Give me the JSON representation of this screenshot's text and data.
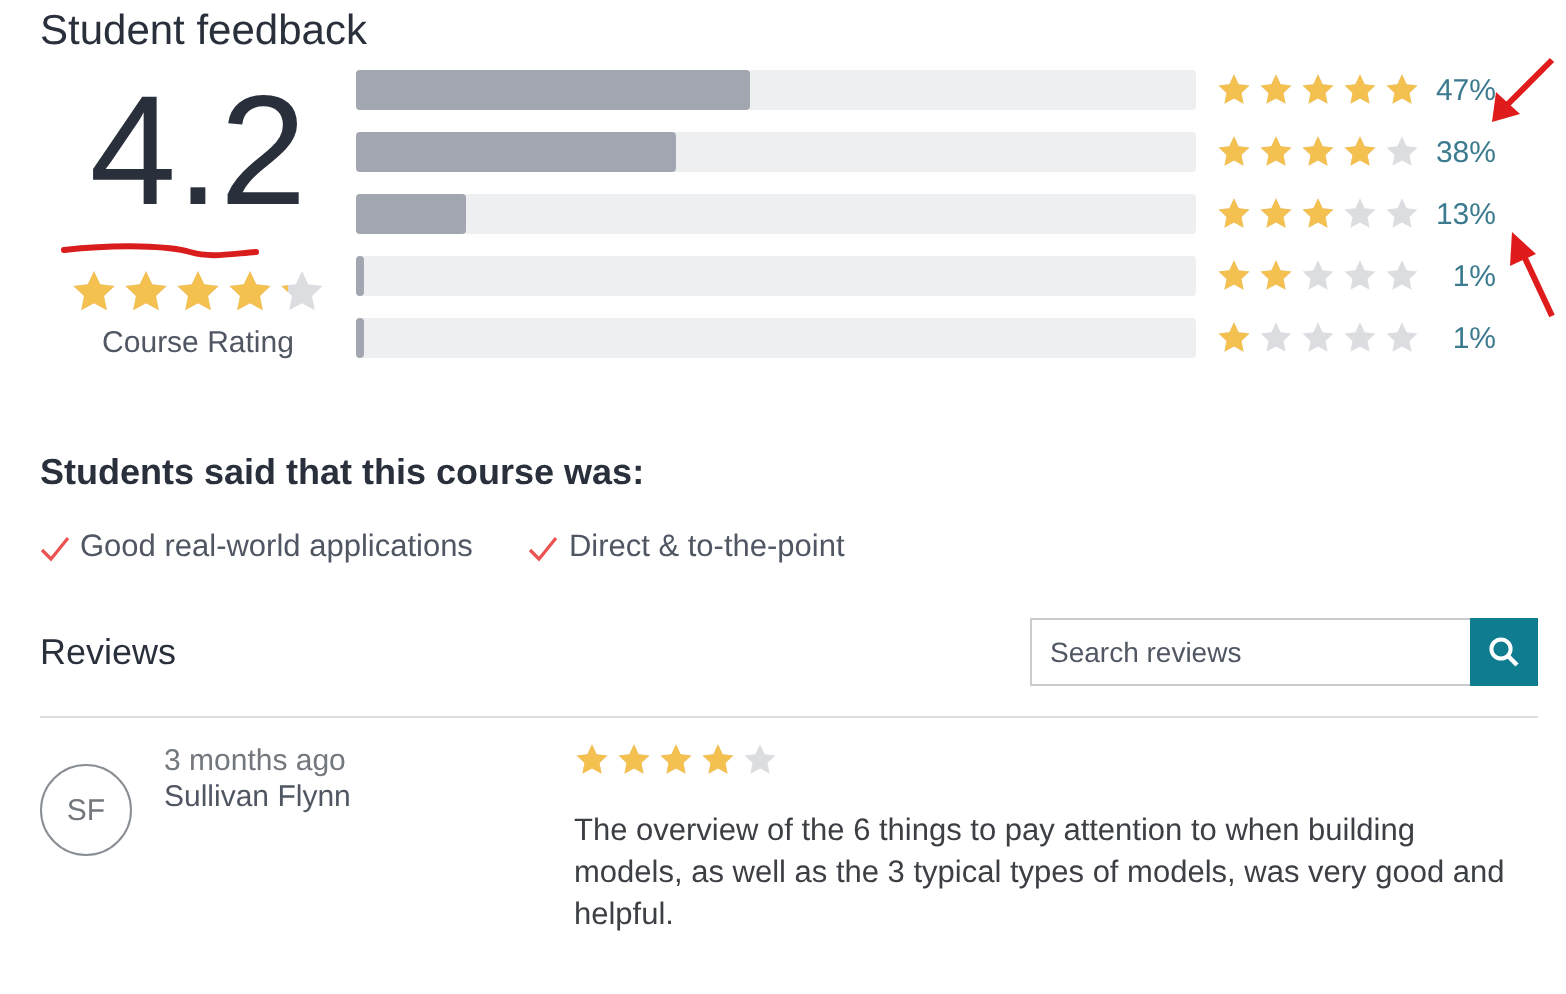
{
  "title": "Student feedback",
  "rating": {
    "value": "4.2",
    "stars": 4.2,
    "label": "Course Rating"
  },
  "breakdown": [
    {
      "level": 0.47,
      "stars": 5,
      "percent": "47%"
    },
    {
      "level": 0.38,
      "stars": 4,
      "percent": "38%"
    },
    {
      "level": 0.13,
      "stars": 3,
      "percent": "13%"
    },
    {
      "level": 0.01,
      "stars": 2,
      "percent": "1%"
    },
    {
      "level": 0.01,
      "stars": 1,
      "percent": "1%"
    }
  ],
  "said": {
    "heading": "Students said that this course was:",
    "tags": [
      "Good real-world applications",
      "Direct & to-the-point"
    ]
  },
  "reviews": {
    "heading": "Reviews",
    "search": {
      "placeholder": "Search reviews"
    },
    "items": [
      {
        "initials": "SF",
        "time": "3 months ago",
        "name": "Sullivan Flynn",
        "stars": 4,
        "text": "The overview of the 6 things to pay attention to when building models, as well as the 3 typical types of models, was very good and helpful."
      }
    ]
  }
}
